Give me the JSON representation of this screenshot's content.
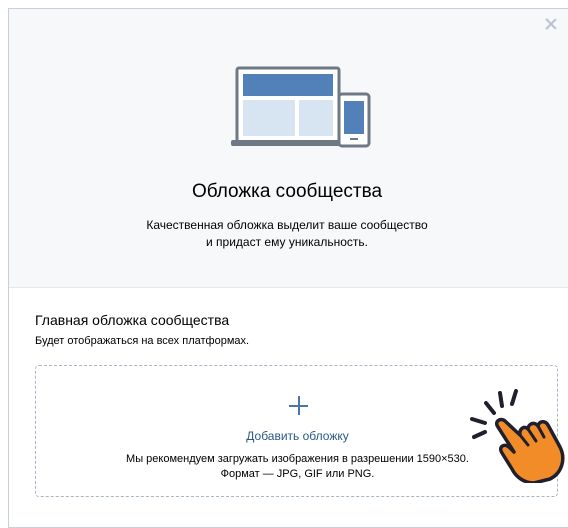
{
  "header": {
    "title": "Обложка сообщества",
    "subtitle_line1": "Качественная обложка выделит ваше сообщество",
    "subtitle_line2": "и придаст ему уникальность."
  },
  "section": {
    "title": "Главная обложка сообщества",
    "description": "Будет отображаться на всех платформах."
  },
  "upload": {
    "add_label": "Добавить обложку",
    "hint_line1": "Мы рекомендуем загружать изображения в разрешении 1590×530.",
    "hint_line2": "Формат — JPG, GIF или PNG."
  },
  "icons": {
    "close": "close-icon",
    "plus": "plus-icon",
    "illustration": "devices-illustration-icon",
    "pointer": "pointing-hand-icon"
  },
  "colors": {
    "accent": "#4a76a8",
    "link": "#2a5885",
    "illustration_blue": "#5181b8",
    "hand_orange": "#f28c28"
  }
}
